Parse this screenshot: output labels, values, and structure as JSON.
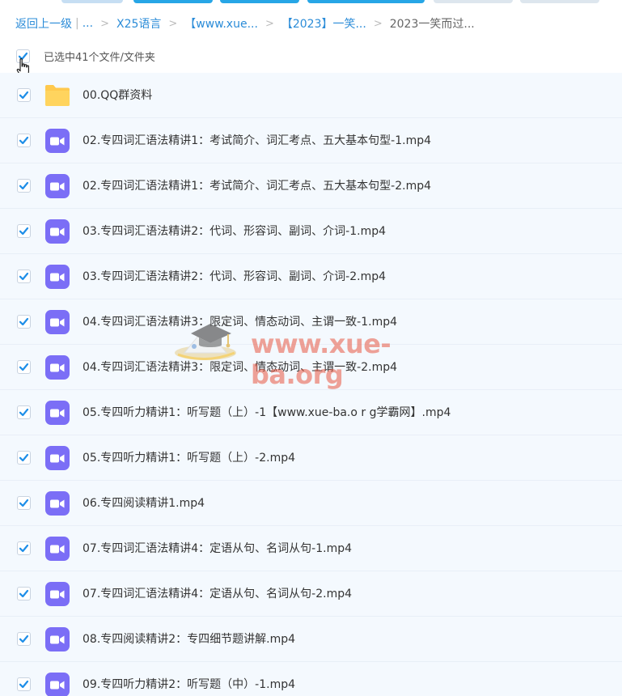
{
  "breadcrumb": {
    "back": "返回上一级",
    "ellipsis": "...",
    "items": [
      "X25语言",
      "【www.xue...",
      "【2023】一笑...",
      "2023一笑而过..."
    ]
  },
  "selection": {
    "text": "已选中41个文件/文件夹"
  },
  "files": [
    {
      "name": "00.QQ群资料",
      "type": "folder-icon"
    },
    {
      "name": "02.专四词汇语法精讲1：考试简介、词汇考点、五大基本句型-1.mp4",
      "type": "video-icon"
    },
    {
      "name": "02.专四词汇语法精讲1：考试简介、词汇考点、五大基本句型-2.mp4",
      "type": "video-icon"
    },
    {
      "name": "03.专四词汇语法精讲2：代词、形容词、副词、介词-1.mp4",
      "type": "video-icon"
    },
    {
      "name": "03.专四词汇语法精讲2：代词、形容词、副词、介词-2.mp4",
      "type": "video-icon"
    },
    {
      "name": "04.专四词汇语法精讲3：限定词、情态动词、主谓一致-1.mp4",
      "type": "video-icon"
    },
    {
      "name": "04.专四词汇语法精讲3：限定词、情态动词、主谓一致-2.mp4",
      "type": "video-icon"
    },
    {
      "name": "05.专四听力精讲1：听写题（上）-1【www.xue-ba.o r g学霸网】.mp4",
      "type": "video-icon"
    },
    {
      "name": "05.专四听力精讲1：听写题（上）-2.mp4",
      "type": "video-icon"
    },
    {
      "name": "06.专四阅读精讲1.mp4",
      "type": "video-icon"
    },
    {
      "name": "07.专四词汇语法精讲4：定语从句、名词从句-1.mp4",
      "type": "video-icon"
    },
    {
      "name": "07.专四词汇语法精讲4：定语从句、名词从句-2.mp4",
      "type": "video-icon"
    },
    {
      "name": "08.专四阅读精讲2：专四细节题讲解.mp4",
      "type": "video-icon"
    },
    {
      "name": "09.专四听力精讲2：听写题（中）-1.mp4",
      "type": "video-icon"
    }
  ],
  "watermark": {
    "text": "www.xue-ba.org"
  },
  "colors": {
    "link": "#2b8cd8",
    "check": "#1e8ee8",
    "video": "#7b6ef6",
    "folder": "#ffc94d",
    "row_bg": "#f4f9fe"
  }
}
